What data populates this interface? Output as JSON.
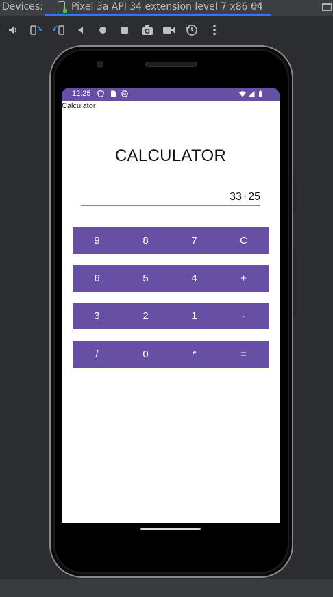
{
  "ide": {
    "panel_title": "Devices:",
    "tab_title": "Pixel 3a API 34 extension level 7 x86 64",
    "tab_close": "✕",
    "toolbar": [
      {
        "name": "volume-icon",
        "glyph": "🔈"
      },
      {
        "name": "rotate-left-icon",
        "glyph": "⟲"
      },
      {
        "name": "rotate-right-icon",
        "glyph": "⟳"
      },
      {
        "name": "back-icon",
        "glyph": "◀"
      },
      {
        "name": "home-icon",
        "glyph": "●"
      },
      {
        "name": "overview-icon",
        "glyph": "■"
      },
      {
        "name": "camera-icon",
        "glyph": "📷"
      },
      {
        "name": "record-icon",
        "glyph": "🎥"
      },
      {
        "name": "snapshot-icon",
        "glyph": "⟲"
      },
      {
        "name": "more-icon",
        "glyph": "⋮"
      }
    ]
  },
  "device": {
    "status_time": "12:25",
    "status_bar_color": "#6750a4",
    "app_label": "Calculator"
  },
  "app": {
    "title": "CALCULATOR",
    "display_value": "33+25",
    "key_color": "#6750a4",
    "rows": [
      [
        "9",
        "8",
        "7",
        "C"
      ],
      [
        "6",
        "5",
        "4",
        "+"
      ],
      [
        "3",
        "2",
        "1",
        "-"
      ],
      [
        "/",
        "0",
        "*",
        "="
      ]
    ]
  }
}
